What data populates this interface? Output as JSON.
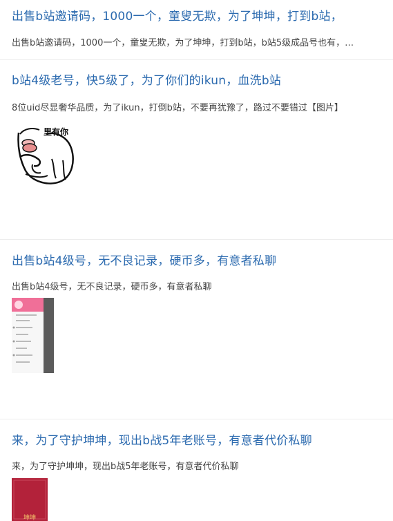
{
  "posts": [
    {
      "title": "出售b站邀请码，1000一个，童叟无欺，为了坤坤，打到b站，",
      "summary": "出售b站邀请码，1000一个，童叟无欺，为了坤坤，打到b站，b站5级成品号也有，…"
    },
    {
      "title": "b站4级老号，快5级了，为了你们的ikun，血洗b站",
      "summary": "8位uid尽显奢华品质，为了ikun，打倒b站，不要再犹豫了，路过不要错过【图片】",
      "image_caption": "里有你"
    },
    {
      "title": "出售b站4级号，无不良记录，硬币多，有意者私聊",
      "summary": "出售b站4级号，无不良记录，硬币多，有意者私聊"
    },
    {
      "title": "来，为了守护坤坤，现出b战5年老账号，有意者代价私聊",
      "summary": "来，为了守护坤坤，现出b战5年老账号，有意者代价私聊",
      "image_caption": "坤坤"
    }
  ],
  "colors": {
    "title": "#2b6aaf",
    "summary": "#444444",
    "divider": "#ececec"
  }
}
